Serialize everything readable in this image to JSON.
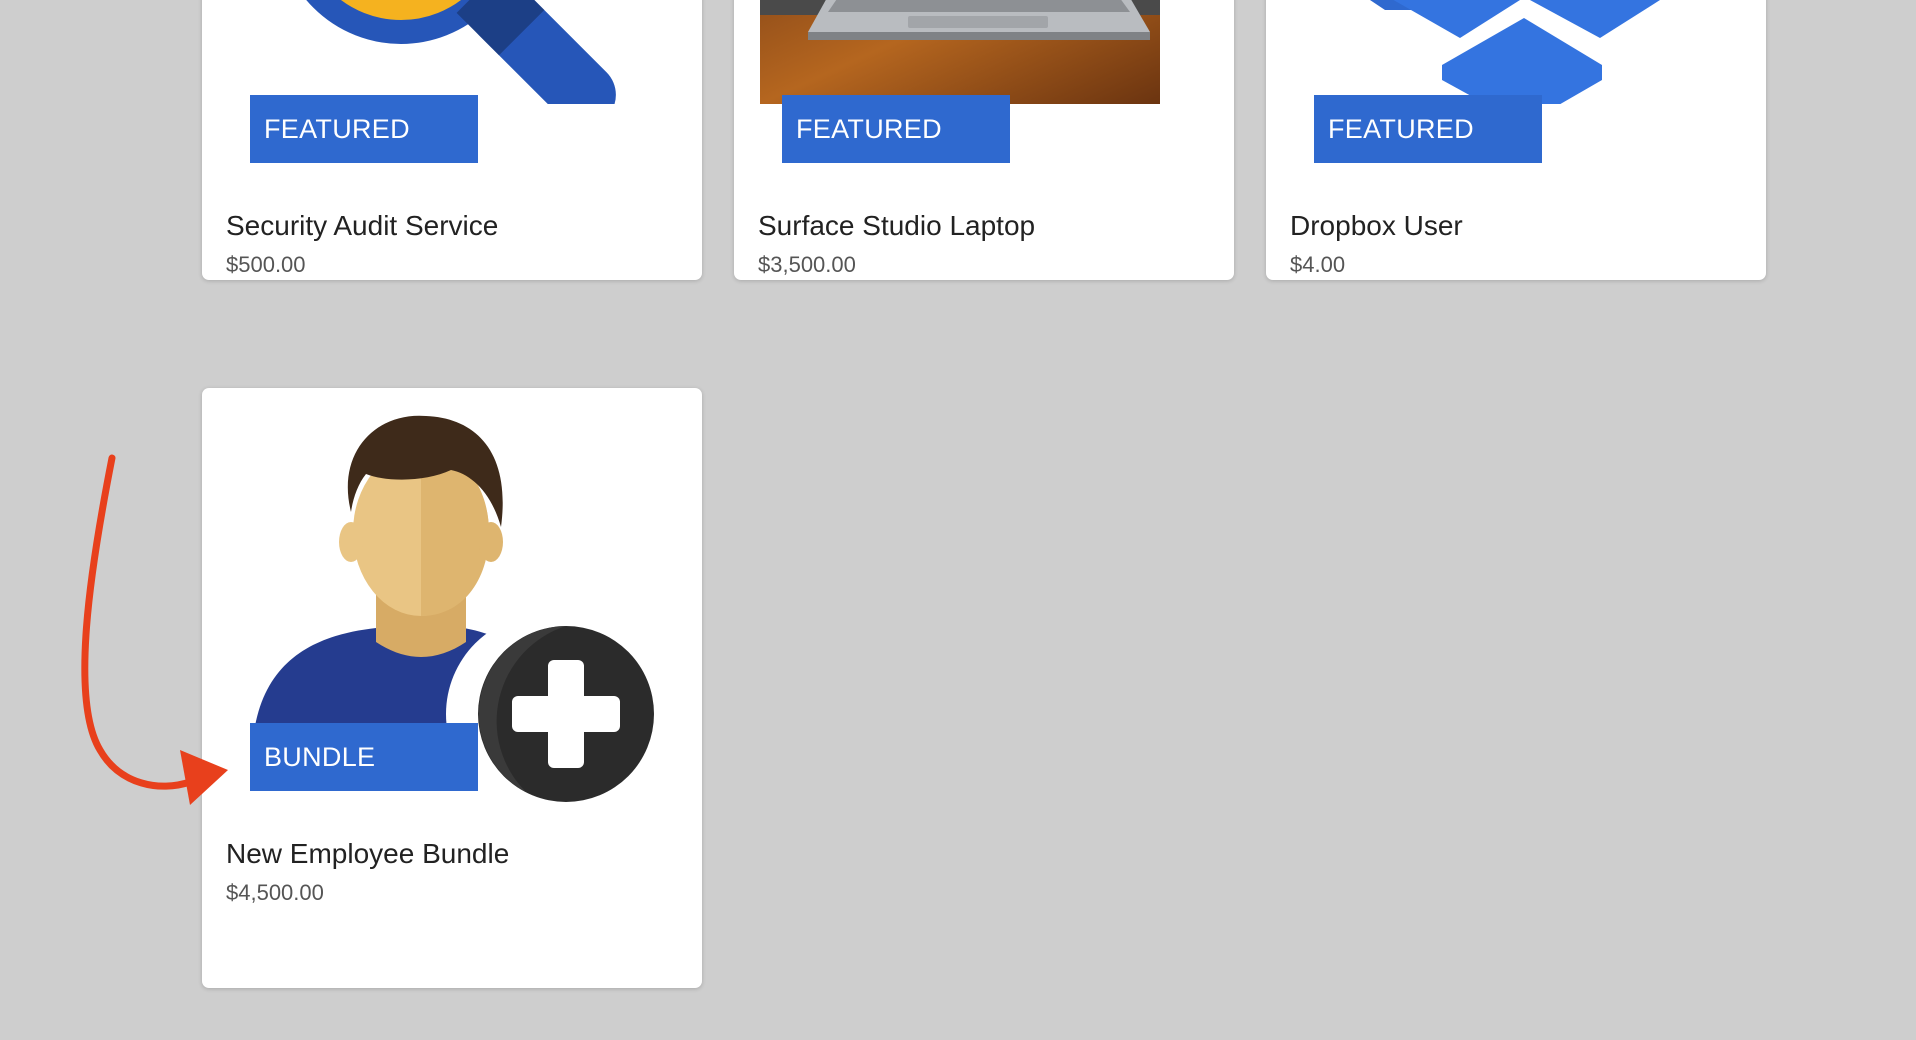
{
  "catalog": {
    "items": [
      {
        "title": "Security Audit Service",
        "price": "$500.00",
        "badge": "FEATURED",
        "image_icon": "magnifier-icon"
      },
      {
        "title": "Surface Studio Laptop",
        "price": "$3,500.00",
        "badge": "FEATURED",
        "image_icon": "laptop-photo"
      },
      {
        "title": "Dropbox User",
        "price": "$4.00",
        "badge": "FEATURED",
        "image_icon": "dropbox-icon"
      },
      {
        "title": "New Employee Bundle",
        "price": "$4,500.00",
        "badge": "BUNDLE",
        "image_icon": "add-user-icon"
      }
    ]
  },
  "colors": {
    "page_background": "#cecece",
    "card_background": "#ffffff",
    "badge": "#2f69cf",
    "annotation_arrow": "#e8401c"
  },
  "annotation": {
    "icon": "red-curved-arrow-icon"
  }
}
